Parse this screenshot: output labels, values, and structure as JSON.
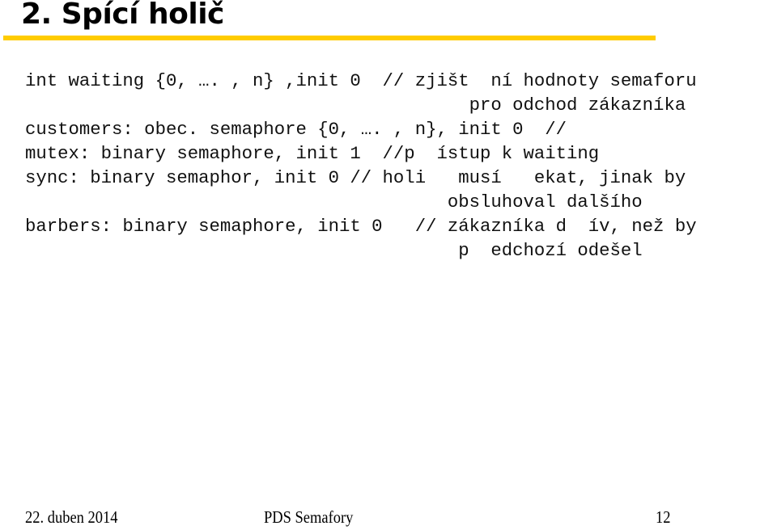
{
  "slide": {
    "title": "2. Spící holič",
    "accent_color": "#ffcc00",
    "code_lines": [
      "int waiting {0, …. , n} ,init 0  // zjišt  ní hodnoty semaforu",
      "                                         pro odchod zákazníka",
      "customers: obec. semaphore {0, …. , n}, init 0  //",
      "mutex: binary semaphore, init 1  //p  ístup k waiting",
      "sync: binary semaphor, init 0 // holi   musí   ekat, jinak by",
      "                                       obsluhoval dalšího",
      "barbers: binary semaphore, init 0   // zákazníka d  ív, než by",
      "                                        p  edchozí odešel"
    ]
  },
  "footer": {
    "date": "22. duben 2014",
    "title": "PDS Semafory",
    "page_number": "12"
  }
}
